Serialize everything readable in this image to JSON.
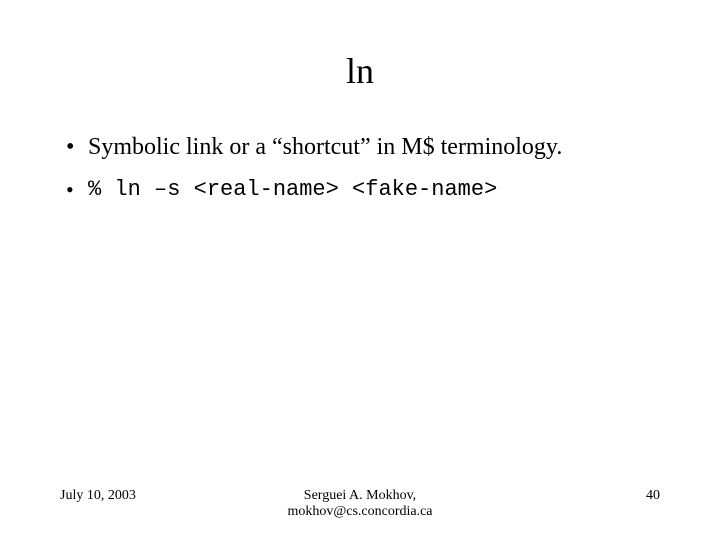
{
  "title": "ln",
  "bullets": {
    "b1": "Symbolic link or a “shortcut” in M$ terminology.",
    "b2": "% ln –s <real-name> <fake-name>"
  },
  "footer": {
    "date": "July 10, 2003",
    "author_line1": "Serguei A. Mokhov,",
    "author_line2": "mokhov@cs.concordia.ca",
    "page": "40"
  }
}
